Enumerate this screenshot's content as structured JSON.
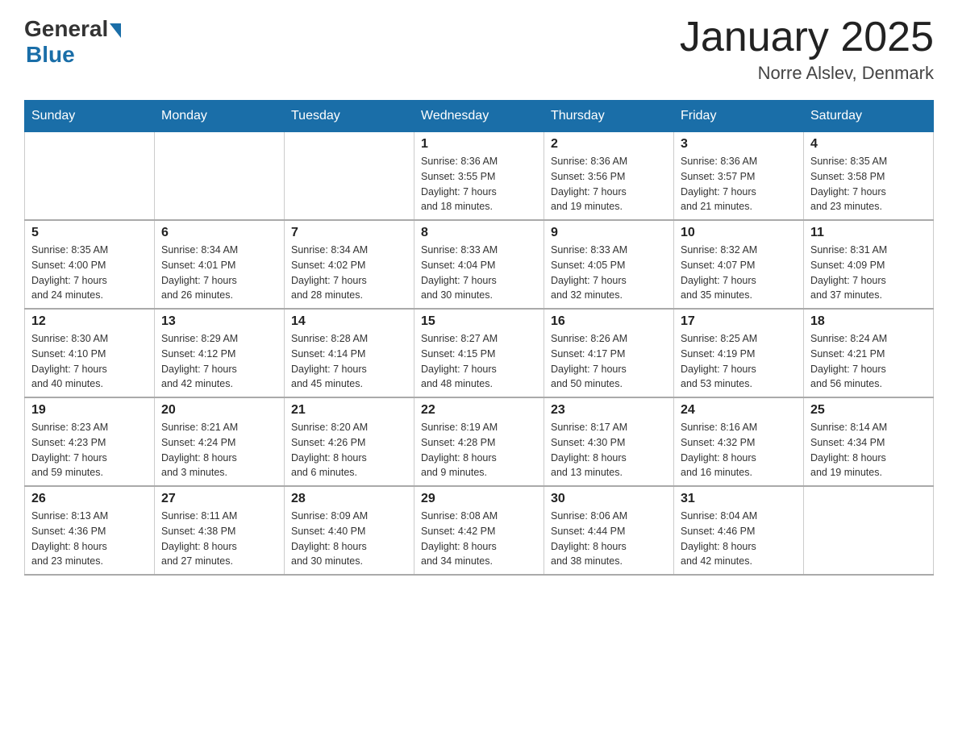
{
  "logo": {
    "general": "General",
    "blue": "Blue"
  },
  "title": {
    "month_year": "January 2025",
    "location": "Norre Alslev, Denmark"
  },
  "days_of_week": [
    "Sunday",
    "Monday",
    "Tuesday",
    "Wednesday",
    "Thursday",
    "Friday",
    "Saturday"
  ],
  "weeks": [
    [
      {
        "day": "",
        "info": ""
      },
      {
        "day": "",
        "info": ""
      },
      {
        "day": "",
        "info": ""
      },
      {
        "day": "1",
        "info": "Sunrise: 8:36 AM\nSunset: 3:55 PM\nDaylight: 7 hours\nand 18 minutes."
      },
      {
        "day": "2",
        "info": "Sunrise: 8:36 AM\nSunset: 3:56 PM\nDaylight: 7 hours\nand 19 minutes."
      },
      {
        "day": "3",
        "info": "Sunrise: 8:36 AM\nSunset: 3:57 PM\nDaylight: 7 hours\nand 21 minutes."
      },
      {
        "day": "4",
        "info": "Sunrise: 8:35 AM\nSunset: 3:58 PM\nDaylight: 7 hours\nand 23 minutes."
      }
    ],
    [
      {
        "day": "5",
        "info": "Sunrise: 8:35 AM\nSunset: 4:00 PM\nDaylight: 7 hours\nand 24 minutes."
      },
      {
        "day": "6",
        "info": "Sunrise: 8:34 AM\nSunset: 4:01 PM\nDaylight: 7 hours\nand 26 minutes."
      },
      {
        "day": "7",
        "info": "Sunrise: 8:34 AM\nSunset: 4:02 PM\nDaylight: 7 hours\nand 28 minutes."
      },
      {
        "day": "8",
        "info": "Sunrise: 8:33 AM\nSunset: 4:04 PM\nDaylight: 7 hours\nand 30 minutes."
      },
      {
        "day": "9",
        "info": "Sunrise: 8:33 AM\nSunset: 4:05 PM\nDaylight: 7 hours\nand 32 minutes."
      },
      {
        "day": "10",
        "info": "Sunrise: 8:32 AM\nSunset: 4:07 PM\nDaylight: 7 hours\nand 35 minutes."
      },
      {
        "day": "11",
        "info": "Sunrise: 8:31 AM\nSunset: 4:09 PM\nDaylight: 7 hours\nand 37 minutes."
      }
    ],
    [
      {
        "day": "12",
        "info": "Sunrise: 8:30 AM\nSunset: 4:10 PM\nDaylight: 7 hours\nand 40 minutes."
      },
      {
        "day": "13",
        "info": "Sunrise: 8:29 AM\nSunset: 4:12 PM\nDaylight: 7 hours\nand 42 minutes."
      },
      {
        "day": "14",
        "info": "Sunrise: 8:28 AM\nSunset: 4:14 PM\nDaylight: 7 hours\nand 45 minutes."
      },
      {
        "day": "15",
        "info": "Sunrise: 8:27 AM\nSunset: 4:15 PM\nDaylight: 7 hours\nand 48 minutes."
      },
      {
        "day": "16",
        "info": "Sunrise: 8:26 AM\nSunset: 4:17 PM\nDaylight: 7 hours\nand 50 minutes."
      },
      {
        "day": "17",
        "info": "Sunrise: 8:25 AM\nSunset: 4:19 PM\nDaylight: 7 hours\nand 53 minutes."
      },
      {
        "day": "18",
        "info": "Sunrise: 8:24 AM\nSunset: 4:21 PM\nDaylight: 7 hours\nand 56 minutes."
      }
    ],
    [
      {
        "day": "19",
        "info": "Sunrise: 8:23 AM\nSunset: 4:23 PM\nDaylight: 7 hours\nand 59 minutes."
      },
      {
        "day": "20",
        "info": "Sunrise: 8:21 AM\nSunset: 4:24 PM\nDaylight: 8 hours\nand 3 minutes."
      },
      {
        "day": "21",
        "info": "Sunrise: 8:20 AM\nSunset: 4:26 PM\nDaylight: 8 hours\nand 6 minutes."
      },
      {
        "day": "22",
        "info": "Sunrise: 8:19 AM\nSunset: 4:28 PM\nDaylight: 8 hours\nand 9 minutes."
      },
      {
        "day": "23",
        "info": "Sunrise: 8:17 AM\nSunset: 4:30 PM\nDaylight: 8 hours\nand 13 minutes."
      },
      {
        "day": "24",
        "info": "Sunrise: 8:16 AM\nSunset: 4:32 PM\nDaylight: 8 hours\nand 16 minutes."
      },
      {
        "day": "25",
        "info": "Sunrise: 8:14 AM\nSunset: 4:34 PM\nDaylight: 8 hours\nand 19 minutes."
      }
    ],
    [
      {
        "day": "26",
        "info": "Sunrise: 8:13 AM\nSunset: 4:36 PM\nDaylight: 8 hours\nand 23 minutes."
      },
      {
        "day": "27",
        "info": "Sunrise: 8:11 AM\nSunset: 4:38 PM\nDaylight: 8 hours\nand 27 minutes."
      },
      {
        "day": "28",
        "info": "Sunrise: 8:09 AM\nSunset: 4:40 PM\nDaylight: 8 hours\nand 30 minutes."
      },
      {
        "day": "29",
        "info": "Sunrise: 8:08 AM\nSunset: 4:42 PM\nDaylight: 8 hours\nand 34 minutes."
      },
      {
        "day": "30",
        "info": "Sunrise: 8:06 AM\nSunset: 4:44 PM\nDaylight: 8 hours\nand 38 minutes."
      },
      {
        "day": "31",
        "info": "Sunrise: 8:04 AM\nSunset: 4:46 PM\nDaylight: 8 hours\nand 42 minutes."
      },
      {
        "day": "",
        "info": ""
      }
    ]
  ]
}
